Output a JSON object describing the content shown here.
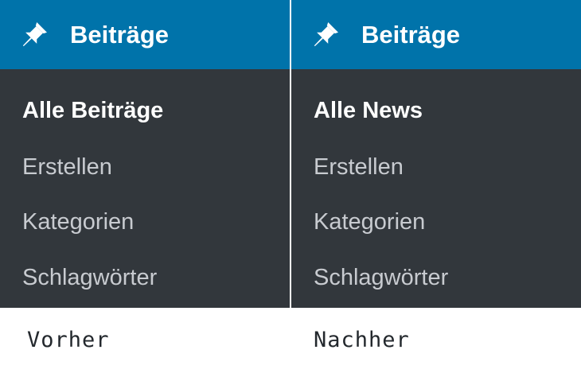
{
  "colors": {
    "header_background": "#0073aa",
    "menu_background": "#32373c",
    "current_item_text": "#ffffff",
    "item_text": "#c8cbd0",
    "caption_text": "#23282d"
  },
  "panels": [
    {
      "header": {
        "icon": "pushpin-icon",
        "label": "Beiträge"
      },
      "items": [
        {
          "label": "Alle Beiträge",
          "current": true
        },
        {
          "label": "Erstellen",
          "current": false
        },
        {
          "label": "Kategorien",
          "current": false
        },
        {
          "label": "Schlagwörter",
          "current": false
        }
      ],
      "caption": "Vorher"
    },
    {
      "header": {
        "icon": "pushpin-icon",
        "label": "Beiträge"
      },
      "items": [
        {
          "label": "Alle News",
          "current": true
        },
        {
          "label": "Erstellen",
          "current": false
        },
        {
          "label": "Kategorien",
          "current": false
        },
        {
          "label": "Schlagwörter",
          "current": false
        }
      ],
      "caption": "Nachher"
    }
  ]
}
